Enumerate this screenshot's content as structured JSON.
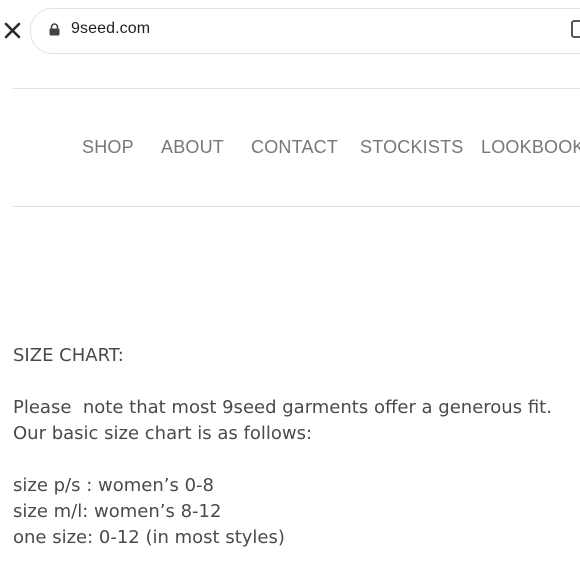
{
  "browser": {
    "url": "9seed.com"
  },
  "nav": {
    "items": [
      "SHOP",
      "ABOUT",
      "CONTACT",
      "STOCKISTS",
      "LOOKBOOK"
    ]
  },
  "content": {
    "heading": "SIZE CHART:",
    "note_line1": "Please  note that most 9seed garments offer a generous fit.",
    "note_line2": "Our basic size chart is as follows:",
    "sizes": [
      "size p/s : women’s 0-8",
      "size m/l: women’s 8-12",
      "one size: 0-12 (in most styles)"
    ]
  },
  "colors": {
    "nav_text": "#777777",
    "body_text": "#4a4a4a",
    "rule": "#e0e0e0"
  }
}
